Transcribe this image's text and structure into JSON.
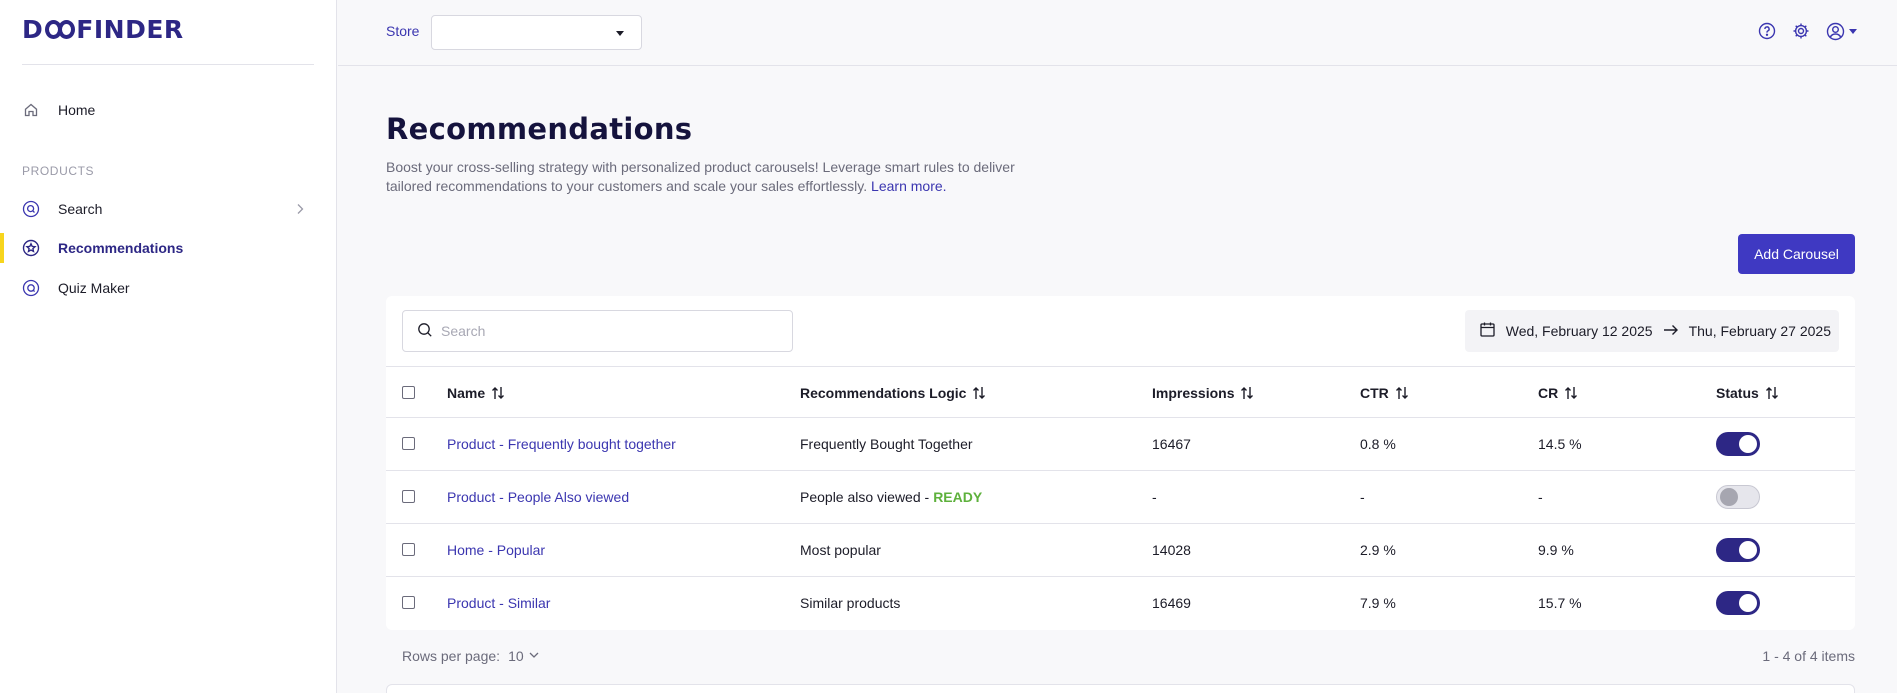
{
  "brand": {
    "logo_pre": "D",
    "logo_post": "FINDER"
  },
  "sidebar": {
    "home_label": "Home",
    "section_label": "PRODUCTS",
    "items": [
      {
        "label": "Search"
      },
      {
        "label": "Recommendations"
      },
      {
        "label": "Quiz Maker"
      }
    ]
  },
  "topbar": {
    "store_label": "Store",
    "store_value": ""
  },
  "page": {
    "title": "Recommendations",
    "description": "Boost your cross-selling strategy with personalized product carousels! Leverage smart rules to deliver tailored recommendations to your customers and scale your sales effortlessly.",
    "learn_more": "Learn more.",
    "add_button": "Add Carousel"
  },
  "filters": {
    "search_placeholder": "Search",
    "date_start": "Wed, February 12 2025",
    "date_end": "Thu, February 27 2025"
  },
  "table": {
    "columns": [
      "Name",
      "Recommendations Logic",
      "Impressions",
      "CTR",
      "CR",
      "Status"
    ],
    "rows": [
      {
        "name": "Product - Frequently bought together",
        "logic": "Frequently Bought Together",
        "logic_status": "",
        "impressions": "16467",
        "ctr": "0.8 %",
        "cr": "14.5 %",
        "enabled": true
      },
      {
        "name": "Product - People Also viewed",
        "logic": "People also viewed -",
        "logic_status": "READY",
        "impressions": "-",
        "ctr": "-",
        "cr": "-",
        "enabled": false
      },
      {
        "name": "Home - Popular",
        "logic": "Most popular",
        "logic_status": "",
        "impressions": "14028",
        "ctr": "2.9 %",
        "cr": "9.9 %",
        "enabled": true
      },
      {
        "name": "Product - Similar",
        "logic": "Similar products",
        "logic_status": "",
        "impressions": "16469",
        "ctr": "7.9 %",
        "cr": "15.7 %",
        "enabled": true
      }
    ]
  },
  "footer": {
    "rows_per_page_label": "Rows per page:",
    "rows_per_page_value": "10",
    "range_text": "1 - 4 of 4 items"
  },
  "colors": {
    "brand": "#2d2785",
    "accent": "#3f39c2",
    "active_marker": "#f7d51d",
    "ready": "#5eb13c"
  },
  "icons": {
    "home": "home-icon",
    "search_nav": "search-circle-icon",
    "recommendations_nav": "star-circle-icon",
    "quiz_nav": "quiz-circle-icon",
    "help": "help-icon",
    "settings": "gear-icon",
    "user": "user-icon",
    "calendar": "calendar-icon",
    "arrow": "arrow-right-icon",
    "sort": "sort-icon"
  }
}
